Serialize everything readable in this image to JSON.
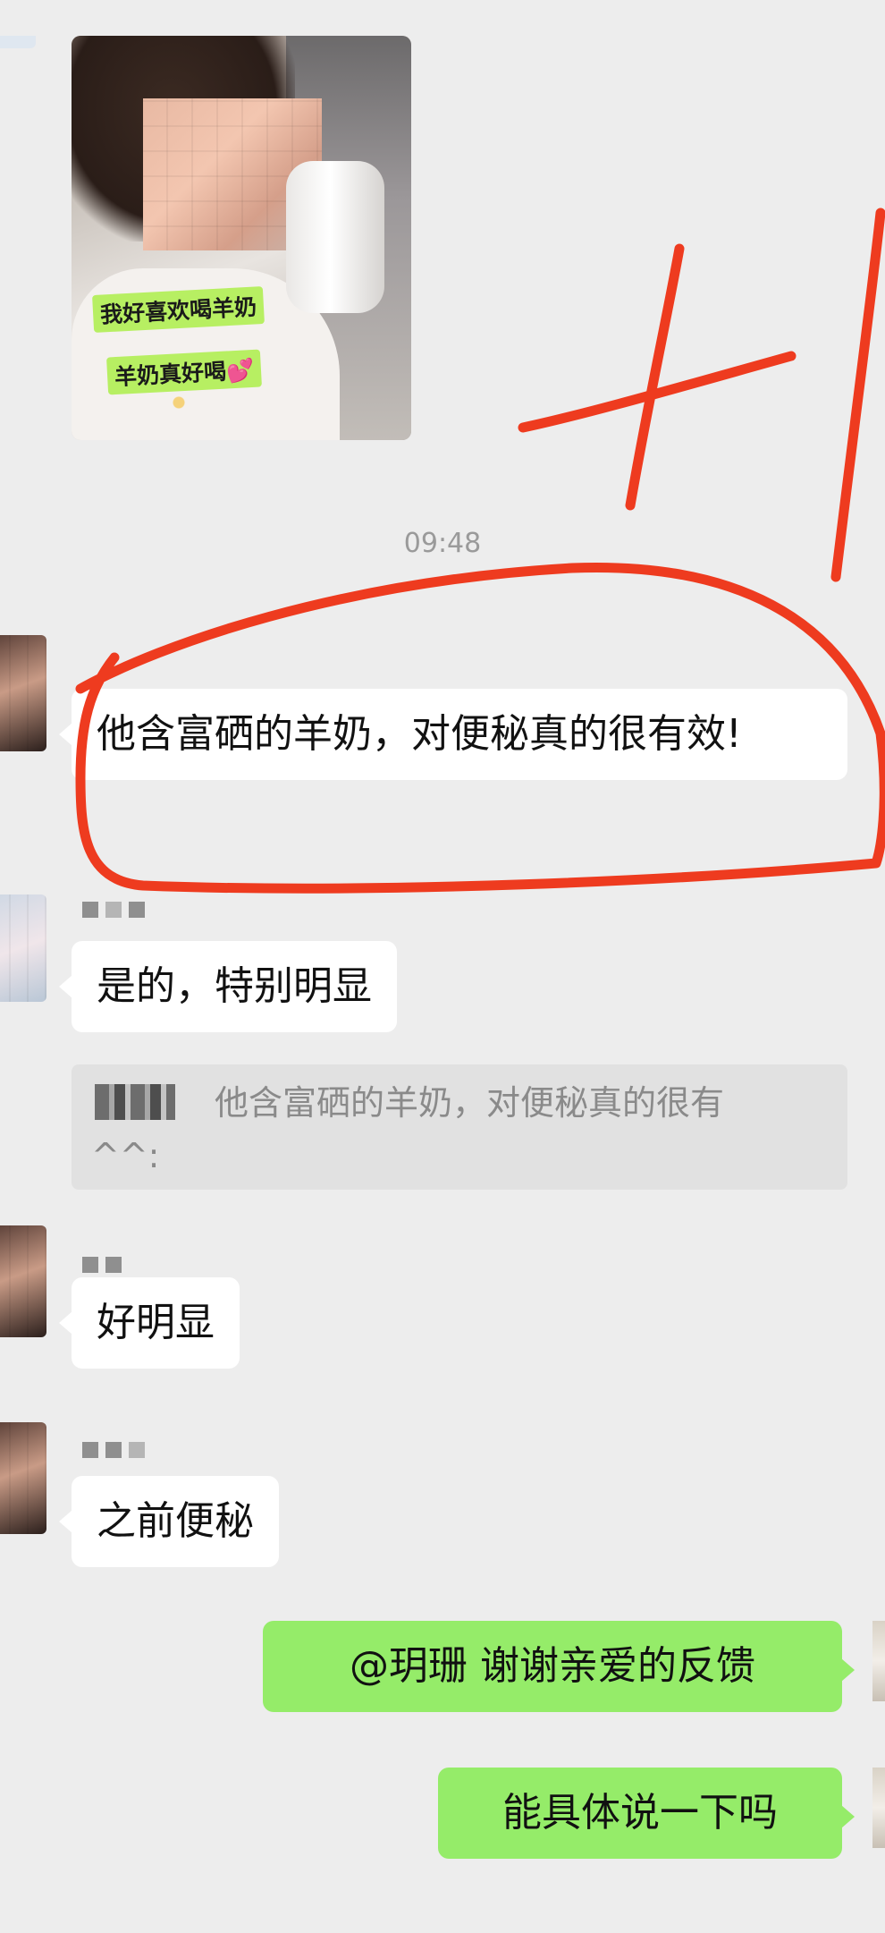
{
  "photo": {
    "caption_line1": "我好喜欢喝羊奶",
    "caption_line2": "羊奶真好喝💕"
  },
  "annotation": {
    "mark_text": "+1",
    "color": "#ee3b1f"
  },
  "time": "09:48",
  "messages": [
    {
      "side": "left",
      "text": "他含富硒的羊奶，对便秘真的很有效!"
    },
    {
      "side": "left",
      "text": "是的，特别明显"
    },
    {
      "side": "left",
      "text": "好明显"
    },
    {
      "side": "left",
      "text": "之前便秘"
    },
    {
      "side": "right",
      "text": "@玥珊  谢谢亲爱的反馈"
    },
    {
      "side": "right",
      "text": "能具体说一下吗"
    }
  ],
  "quote": {
    "text": "他含富硒的羊奶，对便秘真的很有",
    "tail": "^^:"
  },
  "colors": {
    "self_bubble": "#95ec69",
    "other_bubble": "#ffffff",
    "background": "#ededed"
  }
}
